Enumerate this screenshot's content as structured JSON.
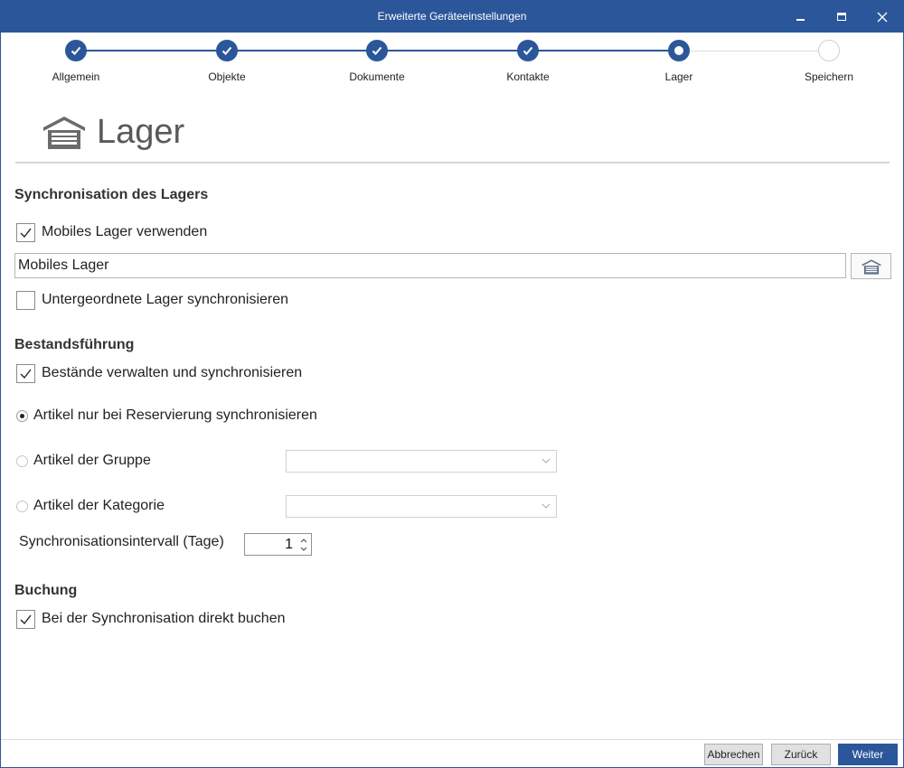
{
  "window": {
    "title": "Erweiterte Geräteeinstellungen",
    "accent_color": "#2b579a"
  },
  "stepper": {
    "steps": [
      {
        "label": "Allgemein",
        "state": "done"
      },
      {
        "label": "Objekte",
        "state": "done"
      },
      {
        "label": "Dokumente",
        "state": "done"
      },
      {
        "label": "Kontakte",
        "state": "done"
      },
      {
        "label": "Lager",
        "state": "current"
      },
      {
        "label": "Speichern",
        "state": "todo"
      }
    ]
  },
  "header": {
    "title": "Lager",
    "icon": "warehouse-icon"
  },
  "sync_section": {
    "title": "Synchronisation des Lagers",
    "use_mobile_label": "Mobiles Lager verwenden",
    "use_mobile_checked": true,
    "warehouse_value": "Mobiles Lager",
    "sub_warehouses_label": "Untergeordnete Lager synchronisieren",
    "sub_warehouses_checked": false
  },
  "stock_section": {
    "title": "Bestandsführung",
    "manage_label": "Bestände verwalten und synchronisieren",
    "manage_checked": true,
    "radio_reservation_label": "Artikel nur bei Reservierung synchronisieren",
    "radio_group_label": "Artikel der Gruppe",
    "radio_category_label": "Artikel der Kategorie",
    "selected_radio": "reservation",
    "group_value": "",
    "category_value": "",
    "interval_label": "Synchronisationsintervall (Tage)",
    "interval_value": "1"
  },
  "booking_section": {
    "title": "Buchung",
    "direct_label": "Bei der Synchronisation direkt buchen",
    "direct_checked": true
  },
  "footer": {
    "cancel_label": "Abbrechen",
    "back_label": "Zurück",
    "next_label": "Weiter"
  }
}
